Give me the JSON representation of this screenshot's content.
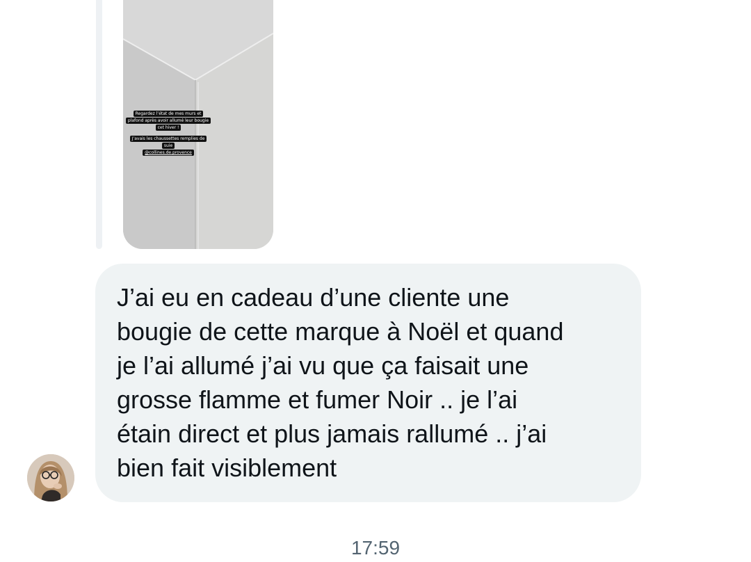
{
  "conversation": {
    "quoted_story": {
      "caption_lines": [
        "Regardez l’état de mes murs et",
        "plafond après avoir allumé leur bougie",
        "cet hiver !"
      ],
      "caption_lines_2": [
        "J’avais les chaussettes remplies de",
        "suie"
      ],
      "mention": "@collines.de.provence"
    },
    "message": {
      "text": "J’ai eu en cadeau d’une cliente une\nbougie de cette marque à Noël et quand\nje l’ai allumé j’ai vu que ça faisait une\ngrosse flamme et fumer Noir .. je l’ai\nétain direct et plus jamais rallumé .. j’ai\nbien fait visiblement"
    },
    "timestamp": "17:59"
  },
  "colors": {
    "bubble_background": "#eff3f4",
    "text": "#0f1419",
    "timestamp": "#536471"
  }
}
